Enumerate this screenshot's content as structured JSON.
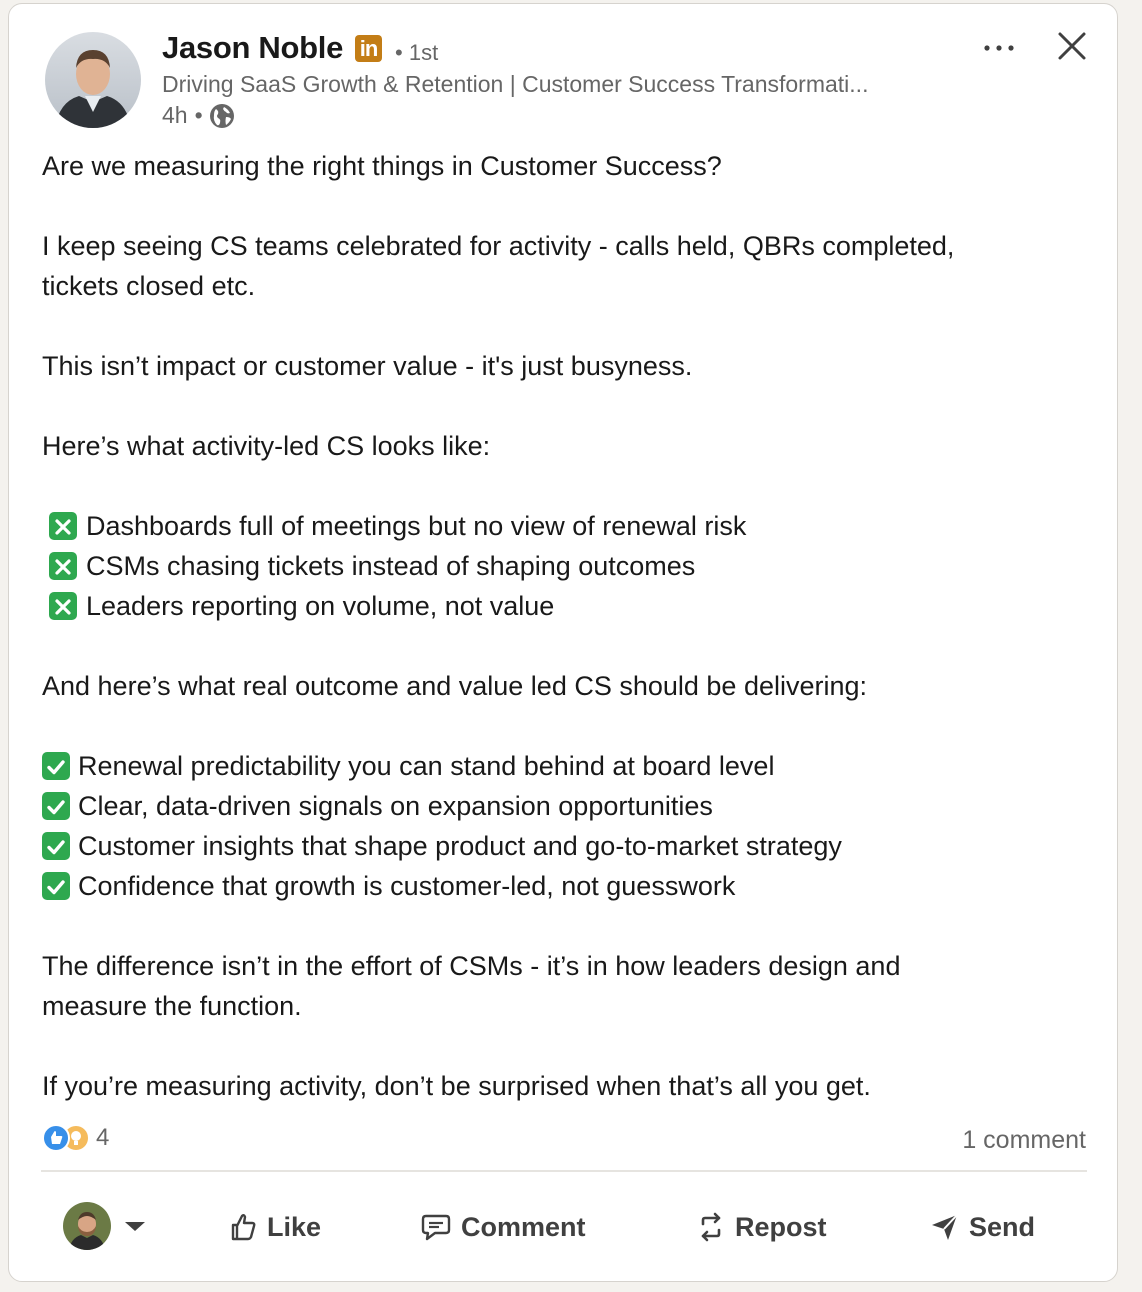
{
  "post": {
    "author": {
      "name": "Jason Noble",
      "badge": "in",
      "degree": "1st",
      "headline": "Driving SaaS Growth & Retention | Customer Success Transformati...",
      "time": "4h",
      "dot": "•"
    },
    "body": {
      "intro": "Are we measuring the right things in Customer Success?",
      "p1": "I keep seeing CS teams celebrated for activity - calls held, QBRs completed,\ntickets closed etc.",
      "p2": "This isn’t impact or customer value - it's just busyness.",
      "p3": "Here’s what activity-led CS looks like:",
      "negatives": [
        "Dashboards full of meetings but no view of renewal risk",
        "CSMs chasing tickets instead of shaping outcomes",
        "Leaders reporting on volume, not value"
      ],
      "p4": "And here’s what real outcome and value led CS should be delivering:",
      "positives": [
        "Renewal predictability you can stand behind at board level",
        "Clear, data-driven signals on expansion opportunities",
        "Customer insights that shape product and go-to-market strategy",
        "Confidence that growth is customer-led, not guesswork"
      ],
      "p5": "The difference isn’t in the effort of CSMs - it’s in how leaders design and\nmeasure the function.",
      "p6": "If you’re measuring activity, don’t be surprised when that’s all you get."
    },
    "social": {
      "reaction_count": "4",
      "reaction_icons": [
        "like-icon",
        "insightful-icon"
      ],
      "comments": "1 comment"
    },
    "actions": {
      "like": "Like",
      "comment": "Comment",
      "repost": "Repost",
      "send": "Send"
    }
  },
  "colors": {
    "linkedin_badge": "#c37d16",
    "check_green": "#2ea84f",
    "text_primary": "#191919",
    "text_secondary": "#666666",
    "like_blue": "#378fe9",
    "insight_yellow": "#f5bb5c"
  }
}
